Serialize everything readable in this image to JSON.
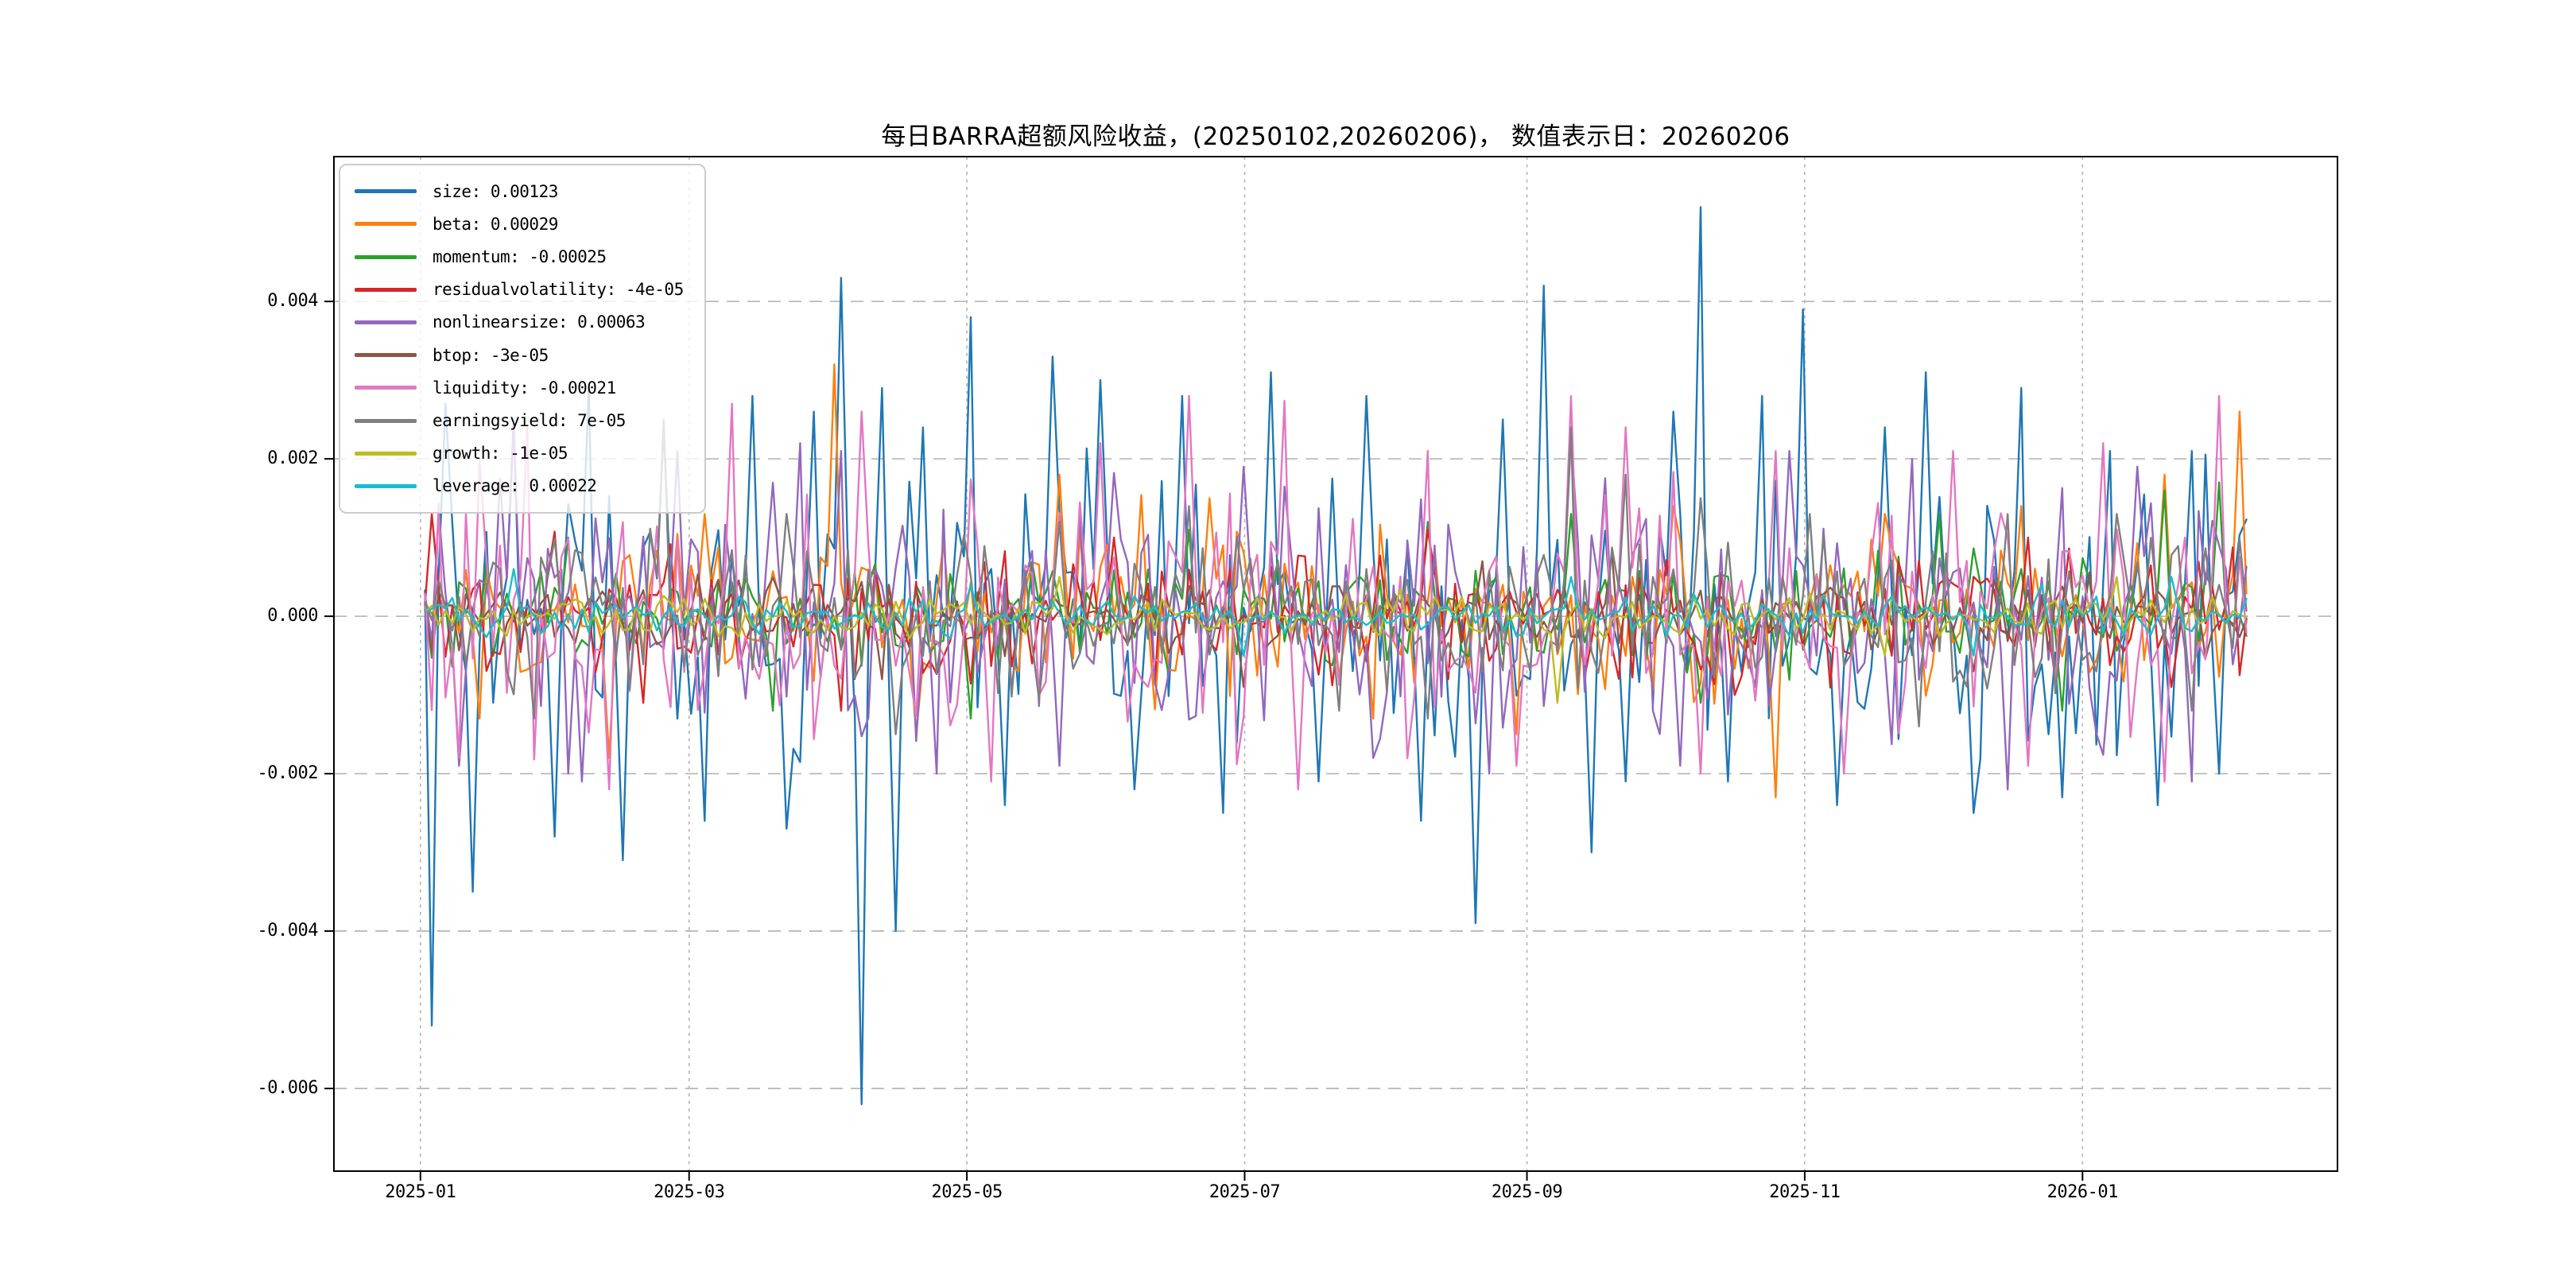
{
  "chart_data": {
    "type": "line",
    "title": "每日BARRA超额风险收益，(20250102,20260206)， 数值表示日：20260206",
    "date_start_label": "20250102",
    "date_end_label": "20260206",
    "value_display_date": "20260206",
    "n_points": 268,
    "grid": true,
    "legend_position": "upper-left",
    "axis_color": "#000000",
    "grid_color": "#bbbbbb",
    "ylim": [
      -0.00705,
      0.00584
    ],
    "data_start_frac": 0.04545,
    "data_end_frac": 0.95455,
    "y_ticks": [
      {
        "label": "0.004",
        "value": 0.004
      },
      {
        "label": "0.002",
        "value": 0.002
      },
      {
        "label": "0.000",
        "value": 0.0
      },
      {
        "label": "-0.002",
        "value": -0.002
      },
      {
        "label": "-0.004",
        "value": -0.004
      },
      {
        "label": "-0.006",
        "value": -0.006
      }
    ],
    "x_ticks": [
      {
        "label": "2025-01",
        "frac": 0.04318
      },
      {
        "label": "2025-03",
        "frac": 0.17727
      },
      {
        "label": "2025-05",
        "frac": 0.31591
      },
      {
        "label": "2025-07",
        "frac": 0.45455
      },
      {
        "label": "2025-09",
        "frac": 0.59545
      },
      {
        "label": "2025-11",
        "frac": 0.73409
      },
      {
        "label": "2026-01",
        "frac": 0.87273
      }
    ],
    "series": [
      {
        "name": "size",
        "legend_label": "size: 0.00123",
        "last_value": 0.00123,
        "color": "#1f77b4",
        "amplitude": 0.0011,
        "spikes": [
          [
            0.003,
            -0.0052
          ],
          [
            0.012,
            0.0027
          ],
          [
            0.026,
            -0.0035
          ],
          [
            0.05,
            0.0025
          ],
          [
            0.07,
            -0.0028
          ],
          [
            0.09,
            0.0029
          ],
          [
            0.11,
            -0.0031
          ],
          [
            0.13,
            0.0024
          ],
          [
            0.155,
            -0.0026
          ],
          [
            0.18,
            0.0028
          ],
          [
            0.2,
            -0.0027
          ],
          [
            0.215,
            0.0026
          ],
          [
            0.228,
            0.0043
          ],
          [
            0.241,
            -0.0062
          ],
          [
            0.25,
            0.0029
          ],
          [
            0.258,
            -0.004
          ],
          [
            0.275,
            0.0024
          ],
          [
            0.3,
            0.0038
          ],
          [
            0.32,
            -0.0024
          ],
          [
            0.345,
            0.0033
          ],
          [
            0.37,
            0.003
          ],
          [
            0.39,
            -0.0022
          ],
          [
            0.415,
            0.0028
          ],
          [
            0.44,
            -0.0025
          ],
          [
            0.465,
            0.0031
          ],
          [
            0.49,
            -0.0021
          ],
          [
            0.515,
            0.0028
          ],
          [
            0.545,
            -0.0026
          ],
          [
            0.575,
            -0.0039
          ],
          [
            0.59,
            0.0025
          ],
          [
            0.615,
            0.0042
          ],
          [
            0.64,
            -0.003
          ],
          [
            0.66,
            -0.0021
          ],
          [
            0.685,
            0.0026
          ],
          [
            0.7,
            0.0052
          ],
          [
            0.715,
            -0.0021
          ],
          [
            0.735,
            0.0028
          ],
          [
            0.755,
            0.0039
          ],
          [
            0.775,
            -0.0024
          ],
          [
            0.8,
            0.0024
          ],
          [
            0.825,
            0.0031
          ],
          [
            0.85,
            -0.0025
          ],
          [
            0.875,
            0.0029
          ],
          [
            0.9,
            -0.0023
          ],
          [
            0.925,
            0.0021
          ],
          [
            0.95,
            -0.0024
          ],
          [
            0.97,
            0.0021
          ],
          [
            0.985,
            -0.002
          ]
        ]
      },
      {
        "name": "beta",
        "legend_label": "beta: 0.00029",
        "last_value": 0.00029,
        "color": "#ff7f0e",
        "amplitude": 0.0006,
        "spikes": [
          [
            0.03,
            -0.0013
          ],
          [
            0.1,
            -0.0018
          ],
          [
            0.155,
            0.0013
          ],
          [
            0.225,
            0.0032
          ],
          [
            0.27,
            -0.0015
          ],
          [
            0.35,
            0.0018
          ],
          [
            0.43,
            0.0015
          ],
          [
            0.52,
            -0.0013
          ],
          [
            0.6,
            -0.0015
          ],
          [
            0.685,
            0.0014
          ],
          [
            0.74,
            -0.0023
          ],
          [
            0.8,
            0.0013
          ],
          [
            0.875,
            0.0014
          ],
          [
            0.955,
            0.0018
          ],
          [
            0.995,
            0.0026
          ]
        ]
      },
      {
        "name": "momentum",
        "legend_label": "momentum: -0.00025",
        "last_value": -0.00025,
        "color": "#2ca02c",
        "amplitude": 0.00042,
        "spikes": [
          [
            0.08,
            0.001
          ],
          [
            0.19,
            -0.0012
          ],
          [
            0.3,
            -0.0013
          ],
          [
            0.42,
            0.0011
          ],
          [
            0.55,
            0.0012
          ],
          [
            0.63,
            0.0013
          ],
          [
            0.7,
            -0.0011
          ],
          [
            0.83,
            0.0013
          ],
          [
            0.9,
            -0.0012
          ],
          [
            0.955,
            0.0016
          ],
          [
            0.985,
            0.0017
          ]
        ]
      },
      {
        "name": "residualvolatility",
        "legend_label": "residualvolatility: -4e-05",
        "last_value": -4e-05,
        "color": "#d62728",
        "amplitude": 0.00048,
        "spikes": [
          [
            0.004,
            0.0013
          ],
          [
            0.12,
            -0.0011
          ],
          [
            0.23,
            -0.0012
          ],
          [
            0.38,
            0.001
          ],
          [
            0.55,
            0.0011
          ],
          [
            0.72,
            -0.001
          ],
          [
            0.88,
            0.001
          ],
          [
            0.96,
            -0.0009
          ]
        ]
      },
      {
        "name": "nonlinearsize",
        "legend_label": "nonlinearsize: 0.00063",
        "last_value": 0.00063,
        "color": "#9467bd",
        "amplitude": 0.00095,
        "spikes": [
          [
            0.018,
            -0.0019
          ],
          [
            0.05,
            0.0024
          ],
          [
            0.085,
            -0.0021
          ],
          [
            0.14,
            0.0021
          ],
          [
            0.205,
            0.0022
          ],
          [
            0.228,
            0.0021
          ],
          [
            0.28,
            -0.002
          ],
          [
            0.35,
            -0.0019
          ],
          [
            0.45,
            0.0019
          ],
          [
            0.52,
            -0.0018
          ],
          [
            0.585,
            -0.002
          ],
          [
            0.63,
            0.0023
          ],
          [
            0.69,
            -0.0019
          ],
          [
            0.75,
            0.0021
          ],
          [
            0.815,
            0.002
          ],
          [
            0.87,
            -0.0022
          ],
          [
            0.94,
            0.0019
          ],
          [
            0.97,
            -0.0021
          ]
        ]
      },
      {
        "name": "btop",
        "legend_label": "btop: -3e-05",
        "last_value": -3e-05,
        "color": "#8c564b",
        "amplitude": 0.00028,
        "spikes": [
          [
            0.25,
            -0.0008
          ],
          [
            0.45,
            -0.0009
          ],
          [
            0.58,
            0.0007
          ],
          [
            0.65,
            0.0008
          ],
          [
            0.85,
            -0.0007
          ]
        ]
      },
      {
        "name": "liquidity",
        "legend_label": "liquidity: -0.00021",
        "last_value": -0.00021,
        "color": "#e377c2",
        "amplitude": 0.00095,
        "spikes": [
          [
            0.02,
            -0.0018
          ],
          [
            0.055,
            0.0024
          ],
          [
            0.1,
            -0.0022
          ],
          [
            0.17,
            0.0027
          ],
          [
            0.24,
            0.0026
          ],
          [
            0.31,
            -0.0021
          ],
          [
            0.37,
            0.0022
          ],
          [
            0.42,
            0.0028
          ],
          [
            0.48,
            -0.0022
          ],
          [
            0.55,
            0.0021
          ],
          [
            0.6,
            -0.0019
          ],
          [
            0.63,
            0.0028
          ],
          [
            0.66,
            0.0024
          ],
          [
            0.7,
            -0.002
          ],
          [
            0.74,
            0.0021
          ],
          [
            0.78,
            -0.002
          ],
          [
            0.84,
            0.0021
          ],
          [
            0.88,
            -0.0019
          ],
          [
            0.92,
            0.0022
          ],
          [
            0.955,
            -0.0021
          ],
          [
            0.985,
            0.0028
          ]
        ]
      },
      {
        "name": "earningsyield",
        "legend_label": "earningsyield: 7e-05",
        "last_value": 7e-05,
        "color": "#7f7f7f",
        "amplitude": 0.0006,
        "spikes": [
          [
            0.06,
            -0.0013
          ],
          [
            0.13,
            0.0025
          ],
          [
            0.2,
            0.0013
          ],
          [
            0.26,
            -0.0015
          ],
          [
            0.35,
            0.0012
          ],
          [
            0.42,
            0.0014
          ],
          [
            0.5,
            -0.0012
          ],
          [
            0.55,
            -0.0013
          ],
          [
            0.63,
            0.0024
          ],
          [
            0.66,
            0.0018
          ],
          [
            0.7,
            0.0015
          ],
          [
            0.76,
            0.0013
          ],
          [
            0.82,
            -0.0014
          ],
          [
            0.87,
            0.0013
          ],
          [
            0.93,
            0.0013
          ],
          [
            0.97,
            -0.0012
          ]
        ]
      },
      {
        "name": "growth",
        "legend_label": "growth: -1e-05",
        "last_value": -1e-05,
        "color": "#bcbd22",
        "amplitude": 0.00015,
        "spikes": [
          [
            0.35,
            0.0005
          ],
          [
            0.62,
            -0.0011
          ],
          [
            0.8,
            -0.0005
          ],
          [
            0.93,
            0.0005
          ]
        ]
      },
      {
        "name": "leverage",
        "legend_label": "leverage: 0.00022",
        "last_value": 0.00022,
        "color": "#17becf",
        "amplitude": 0.00015,
        "spikes": [
          [
            0.05,
            0.0006
          ],
          [
            0.3,
            0.0004
          ],
          [
            0.45,
            -0.0005
          ],
          [
            0.63,
            0.0005
          ],
          [
            0.85,
            -0.0005
          ],
          [
            0.96,
            0.0005
          ]
        ]
      }
    ]
  }
}
